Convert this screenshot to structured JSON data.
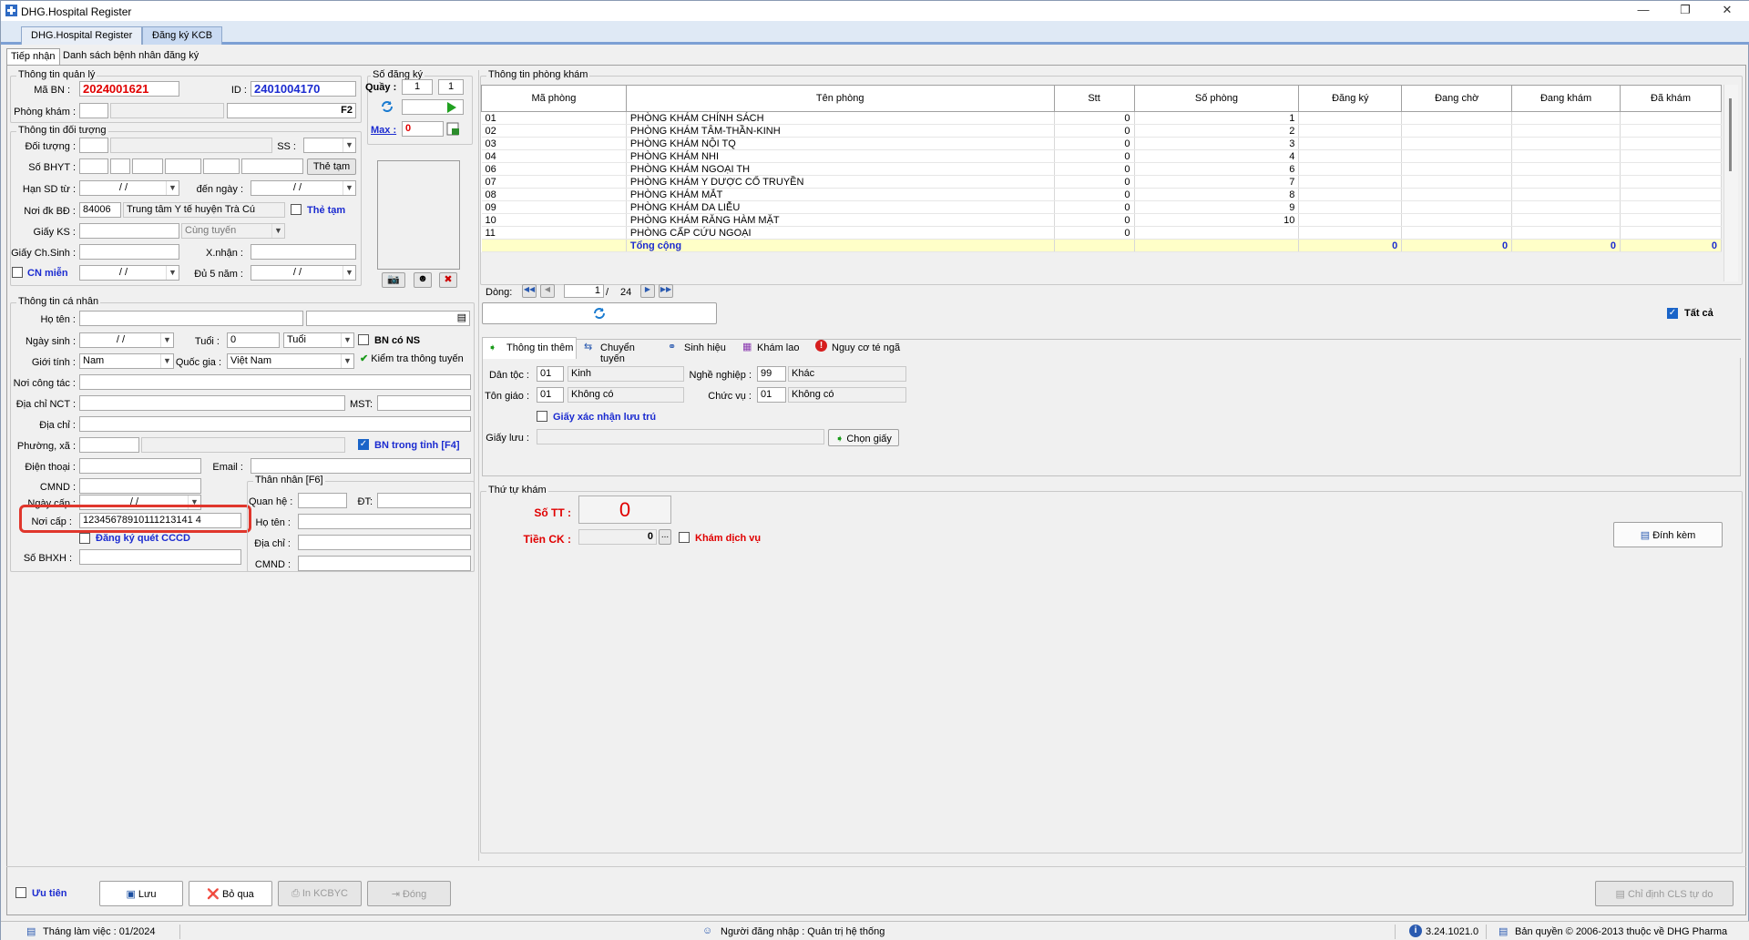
{
  "app": {
    "title": "DHG.Hospital Register"
  },
  "top_tabs": [
    "DHG.Hospital Register",
    "Đăng ký KCB"
  ],
  "sub_tabs": [
    "Tiếp nhận",
    "Danh sách bệnh nhân đăng ký"
  ],
  "quan_ly": {
    "group_title": "Thông tin quản lý",
    "ma_bn_label": "Mã BN :",
    "ma_bn": "2024001621",
    "id_label": "ID :",
    "id": "2401004170",
    "phong_kham_label": "Phòng khám :",
    "f2": "F2"
  },
  "so_dang_ky": {
    "group_title": "Số đăng ký",
    "quay_label": "Quầy :",
    "quay1": "1",
    "quay2": "1",
    "max_label": "Max :",
    "max_value": "0"
  },
  "doi_tuong": {
    "group_title": "Thông tin đối tượng",
    "doi_tuong_label": "Đối tượng :",
    "ss_label": "SS :",
    "so_bhyt_label": "Số BHYT :",
    "the_tam_btn": "Thẻ tạm",
    "han_sd_label": "Hạn SD từ :",
    "den_ngay_label": "đến ngày :",
    "date_blank": "/     /",
    "noi_dk_label": "Nơi đk BĐ :",
    "noi_dk_code": "84006",
    "noi_dk_name": "Trung tâm Y tế huyện Trà Cú",
    "the_tam_chk": "Thẻ tạm",
    "giay_ks_label": "Giấy KS :",
    "cung_tuyen": "Cùng tuyến",
    "giay_chsinh_label": "Giấy Ch.Sinh :",
    "xnhan_label": "X.nhận :",
    "cn_mien": "CN miễn",
    "du5nam_label": "Đủ 5 năm :"
  },
  "ca_nhan": {
    "group_title": "Thông tin cá nhân",
    "ho_ten_label": "Họ tên :",
    "ngay_sinh_label": "Ngày sinh :",
    "tuoi_label": "Tuổi :",
    "tuoi_value": "0",
    "tuoi_unit": "Tuổi",
    "bn_co_ns": "BN có NS",
    "gioi_tinh_label": "Giới tính :",
    "gioi_tinh": "Nam",
    "quoc_gia_label": "Quốc gia :",
    "quoc_gia": "Việt Nam",
    "kiem_tra_btn": "Kiểm tra thông tuyến",
    "noi_cong_tac_label": "Nơi công tác :",
    "dia_chi_nct_label": "Địa chỉ  NCT :",
    "mst_label": "MST:",
    "dia_chi_label": "Địa chỉ :",
    "phuong_xa_label": "Phường, xã :",
    "bn_trong_tinh": "BN trong tỉnh [F4]",
    "dien_thoai_label": "Điện thoại :",
    "email_label": "Email :",
    "cmnd_label": "CMND :",
    "ngay_cap_label": "Ngày cấp :",
    "noi_cap_label": "Nơi cấp :",
    "noi_cap": "12345678910111213141 4",
    "dang_ky_cccd": "Đăng ký quét CCCD",
    "so_bhxh_label": "Số BHXH :"
  },
  "than_nhan": {
    "group_title": "Thân nhân [F6]",
    "quan_he_label": "Quan hệ :",
    "dt_label": "ĐT:",
    "ho_ten_label": "Họ tên :",
    "dia_chi_label": "Địa chỉ :",
    "cmnd_label": "CMND :"
  },
  "phong_kham": {
    "group_title": "Thông tin phòng khám",
    "columns": [
      "Mã phòng",
      "Tên phòng",
      "Stt",
      "Số phòng",
      "Đăng ký",
      "Đang chờ",
      "Đang khám",
      "Đã khám"
    ],
    "rows": [
      [
        "01",
        "PHÒNG KHÁM CHÍNH SÁCH",
        "0",
        "1"
      ],
      [
        "02",
        "PHÒNG KHÁM TÂM-THẦN-KINH",
        "0",
        "2"
      ],
      [
        "03",
        "PHÒNG KHÁM NỘI TQ",
        "0",
        "3"
      ],
      [
        "04",
        "PHÒNG KHÁM NHI",
        "0",
        "4"
      ],
      [
        "06",
        "PHÒNG KHÁM NGOẠI TH",
        "0",
        "6"
      ],
      [
        "07",
        "PHÒNG KHÁM Y DƯỢC CỔ TRUYỀN",
        "0",
        "7"
      ],
      [
        "08",
        "PHÒNG KHÁM MẮT",
        "0",
        "8"
      ],
      [
        "09",
        "PHÒNG KHÁM DA LIỄU",
        "0",
        "9"
      ],
      [
        "10",
        "PHÒNG KHÁM RĂNG HÀM MẶT",
        "0",
        "10"
      ],
      [
        "11",
        "PHÒNG CẤP CỨU NGOẠI",
        "0",
        ""
      ]
    ],
    "total_label": "Tổng cộng",
    "totals": [
      "0",
      "0",
      "0",
      "0"
    ],
    "dong_label": "Dòng:",
    "page": "1",
    "page_sep": "/",
    "page_total": "24",
    "tat_ca": "Tất cả"
  },
  "info_tabs": [
    "Thông tin thêm",
    "Chuyển tuyến",
    "Sinh hiệu",
    "Khám lao",
    "Nguy cơ té ngã"
  ],
  "thong_tin_them": {
    "dan_toc_label": "Dân tộc :",
    "dan_toc_code": "01",
    "dan_toc": "Kinh",
    "nghe_nghiep_label": "Nghề nghiệp :",
    "nghe_nghiep_code": "99",
    "nghe_nghiep": "Khác",
    "ton_giao_label": "Tôn giáo :",
    "ton_giao_code": "01",
    "ton_giao": "Không có",
    "chuc_vu_label": "Chức vụ :",
    "chuc_vu_code": "01",
    "chuc_vu": "Không có",
    "giay_xac_nhan": "Giấy xác nhận lưu trú",
    "giay_luu_label": "Giấy lưu :",
    "chon_giay_btn": "Chọn giấy"
  },
  "thu_tu": {
    "group_title": "Thứ tự khám",
    "so_tt_label": "Số TT :",
    "so_tt": "0",
    "tien_ck_label": "Tiền CK :",
    "tien_ck": "0",
    "kham_dich_vu": "Khám dịch vụ",
    "dinh_kem_btn": "Đính kèm"
  },
  "bottom": {
    "uu_tien": "Ưu tiên",
    "luu": "Lưu",
    "bo_qua": "Bỏ qua",
    "in_kcbyc": "In KCBYC",
    "dong": "Đóng",
    "chi_dinh": "Chỉ định CLS tự do"
  },
  "status": {
    "thang": "Tháng làm việc : 01/2024",
    "nguoi": "Người đăng nhập : Quản trị hệ thống",
    "version": "3.24.1021.0",
    "ban_quyen": "Bản quyền © 2006-2013 thuộc về DHG Pharma"
  },
  "colors": {
    "accent_red": "#e0362c",
    "label_blue": "#1b2bd0",
    "total_yellow": "#ffffc8"
  }
}
